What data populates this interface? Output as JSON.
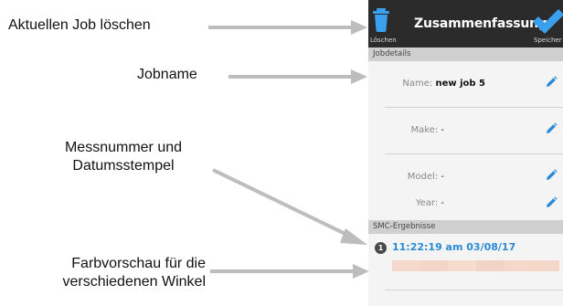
{
  "callouts": {
    "delete_job": "Aktuellen Job löschen",
    "job_name": "Jobname",
    "measure_line1": "Messnummer und",
    "measure_line2": "Datumsstempel",
    "color_line1": "Farbvorschau für die",
    "color_line2": "verschiedenen Winkel"
  },
  "toolbar": {
    "delete_label": "Löschen",
    "title": "Zusammenfassung",
    "save_label": "Speicher"
  },
  "job_details": {
    "header": "Jobdetails",
    "fields": [
      {
        "label": "Name:",
        "value": "new job 5"
      },
      {
        "label": "Make:",
        "value": "-"
      },
      {
        "label": "Model:",
        "value": "-"
      },
      {
        "label": "Year:",
        "value": "-"
      }
    ]
  },
  "smc_results": {
    "header": "SMC-Ergebnisse",
    "items": [
      {
        "index": "1",
        "timestamp": "11:22:19 am 03/08/17"
      }
    ]
  },
  "colors": {
    "toolbar_bg": "#2b2b2b",
    "accent_blue": "#2a8ad6",
    "swatches": [
      "#f5d9cc",
      "#f3d6c8",
      "#f6dccf",
      "#f2d4c6",
      "#f5d8ca",
      "#f4d7c9"
    ]
  }
}
